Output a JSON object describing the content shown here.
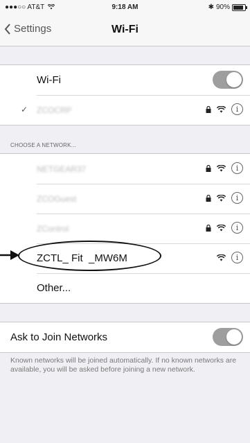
{
  "status_bar": {
    "carrier": "●●●○○ AT&T",
    "time": "9:18 AM",
    "battery": "90%"
  },
  "nav": {
    "back_label": "Settings",
    "title": "Wi-Fi"
  },
  "wifi": {
    "label": "Wi-Fi",
    "enabled": true,
    "connected_network": "ZCOCRP"
  },
  "choose_network": {
    "header": "CHOOSE A NETWORK...",
    "networks": [
      {
        "name": "NETGEAR37",
        "locked": true
      },
      {
        "name": "ZCOGuest",
        "locked": true
      },
      {
        "name": "ZControl",
        "locked": true
      },
      {
        "name": "ZCTL_ Fit  _MW6M",
        "locked": false
      }
    ],
    "other_label": "Other..."
  },
  "ask_to_join": {
    "label": "Ask to Join Networks",
    "enabled": true,
    "description": "Known networks will be joined automatically. If no known networks are available, you will be asked before joining a new network."
  },
  "icons": {
    "info": "i",
    "check": "✓"
  },
  "colors": {
    "background": "#efeff4",
    "toggle_on": "#9e9e9e",
    "annotation": "#111111"
  }
}
